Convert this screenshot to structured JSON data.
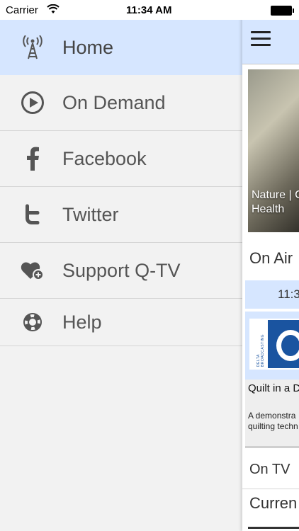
{
  "status_bar": {
    "carrier": "Carrier",
    "time": "11:34 AM"
  },
  "menu": {
    "items": [
      {
        "label": "Home",
        "icon": "antenna-icon",
        "active": true
      },
      {
        "label": "On Demand",
        "icon": "play-circle-icon",
        "active": false
      },
      {
        "label": "Facebook",
        "icon": "facebook-icon",
        "active": false
      },
      {
        "label": "Twitter",
        "icon": "twitter-icon",
        "active": false
      },
      {
        "label": "Support Q-TV",
        "icon": "heart-plus-icon",
        "active": false
      },
      {
        "label": "Help",
        "icon": "lifebuoy-icon",
        "active": false
      }
    ]
  },
  "main": {
    "hero_caption_line1": "Nature | C",
    "hero_caption_line2": "Health",
    "on_air_heading": "On Air",
    "time_slot": "11:3",
    "program": {
      "logo_vertical_text": "DELTA BROADCASTING",
      "title": "Quilt in a D",
      "description_line1": "A demonstra",
      "description_line2": "quilting techn"
    },
    "on_tv_heading": "On TV",
    "current_heading": "Curren"
  },
  "colors": {
    "active_row": "#d6e6ff",
    "menu_background": "#f2f2f2",
    "brand_blue": "#1a54a0",
    "icon_gray": "#555555"
  }
}
